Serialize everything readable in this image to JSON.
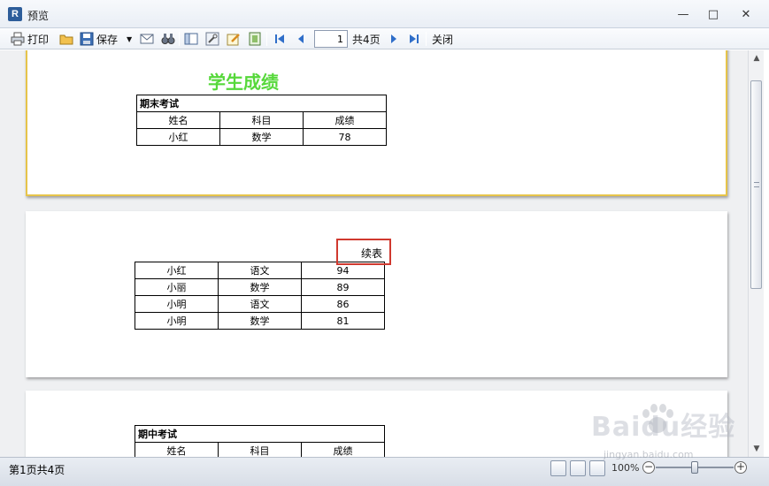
{
  "window": {
    "title": "预览",
    "app_icon": "R"
  },
  "toolbar": {
    "print_label": "打印",
    "save_label": "保存",
    "page_value": "1",
    "total_pages_label": "共4页",
    "close_label": "关闭"
  },
  "report": {
    "title": "学生成绩",
    "title_color": "#56d83a",
    "page1": {
      "caption": "期末考试",
      "headers": [
        "姓名",
        "科目",
        "成绩"
      ],
      "rows": [
        [
          "小红",
          "数学",
          "78"
        ]
      ]
    },
    "page2": {
      "continued_label": "续表",
      "rows": [
        [
          "小红",
          "语文",
          "94"
        ],
        [
          "小丽",
          "数学",
          "89"
        ],
        [
          "小明",
          "语文",
          "86"
        ],
        [
          "小明",
          "数学",
          "81"
        ]
      ]
    },
    "page3": {
      "caption": "期中考试",
      "headers": [
        "姓名",
        "科目",
        "成绩"
      ]
    }
  },
  "status": {
    "page_info": "第1页共4页",
    "zoom": "100%"
  },
  "watermark": {
    "text": "Baidu经验",
    "sub": "jingyan.baidu.com"
  },
  "colors": {
    "highlight_border": "#d0392f",
    "selected_page_border": "#e6c44a"
  }
}
